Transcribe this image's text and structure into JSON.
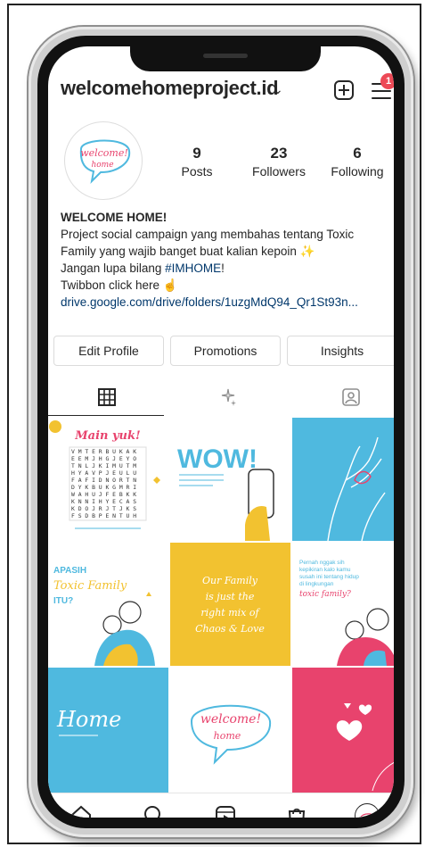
{
  "header": {
    "username": "welcomehomeproject.id",
    "notification_count": "1"
  },
  "profile": {
    "posts_count": "9",
    "posts_label": "Posts",
    "followers_count": "23",
    "followers_label": "Followers",
    "following_count": "6",
    "following_label": "Following",
    "avatar_text_line1": "welcome!",
    "avatar_text_line2": "home"
  },
  "bio": {
    "name": "WELCOME HOME!",
    "line1": "Project social campaign yang membahas tentang Toxic",
    "line2": "Family yang wajib banget buat kalian kepoin",
    "line3_prefix": "Jangan lupa bilang ",
    "hashtag": "#IMHOME",
    "line3_suffix": "!",
    "line4": "Twibbon click here",
    "link": "drive.google.com/drive/folders/1uzgMdQ94_Qr1St93n..."
  },
  "actions": {
    "edit_profile": "Edit Profile",
    "promotions": "Promotions",
    "insights": "Insights"
  },
  "posts": {
    "post1_title": "Main yuk!",
    "post2_title": "WOW!",
    "post4_line1": "APASIH",
    "post4_line2": "Toxic Family",
    "post4_line3": "ITU?",
    "post5_line1": "Our Family",
    "post5_line2": "is just the",
    "post5_line3": "right mix of",
    "post5_line4": "Chaos & Love",
    "post6_line1": "Pernah nggak sih",
    "post6_line2": "kepikiran kalo kamu",
    "post6_line3": "susah ini tentang hidup",
    "post6_line4": "di lingkungan",
    "post6_line5": "toxic family?",
    "post7_title": "Home",
    "post8_line1": "welcome!",
    "post8_line2": "home"
  },
  "colors": {
    "accent_blue": "#4fb9df",
    "accent_yellow": "#f2c230",
    "accent_pink": "#e8436d",
    "link": "#00376b",
    "badge": "#ed4956"
  },
  "icons": {
    "grid_tab": "grid-icon",
    "reels_tab": "sparkle-icon",
    "tagged_tab": "tagged-user-icon",
    "nav_home": "home-icon",
    "nav_search": "search-icon",
    "nav_reels": "reels-icon",
    "nav_shop": "shop-bag-icon",
    "nav_profile": "profile-avatar-icon"
  }
}
